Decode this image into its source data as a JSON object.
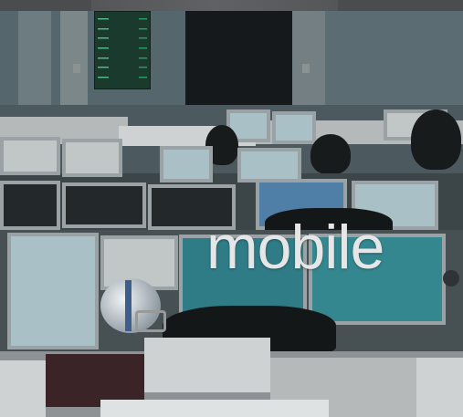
{
  "hero": {
    "headline": "mobile",
    "background_icon": "trading-floor-photo-icon",
    "carousel_icon": "carousel-dot-icon"
  },
  "stock_board": {
    "rows": [
      {
        "a": "▬▬▬▬",
        "b": "▬▬▬"
      },
      {
        "a": "▬▬▬▬",
        "b": "▬▬▬"
      },
      {
        "a": "▬▬▬▬",
        "b": "▬▬▬"
      },
      {
        "a": "▬▬▬▬",
        "b": "▬▬▬"
      },
      {
        "a": "▬▬▬▬",
        "b": "▬▬▬"
      },
      {
        "a": "▬▬▬▬",
        "b": "▬▬▬"
      },
      {
        "a": "▬▬▬▬",
        "b": "▬▬▬"
      }
    ]
  },
  "colors": {
    "headline": "#e6e6e6",
    "board_text": "#58c08a",
    "background": "#3e4b52"
  }
}
